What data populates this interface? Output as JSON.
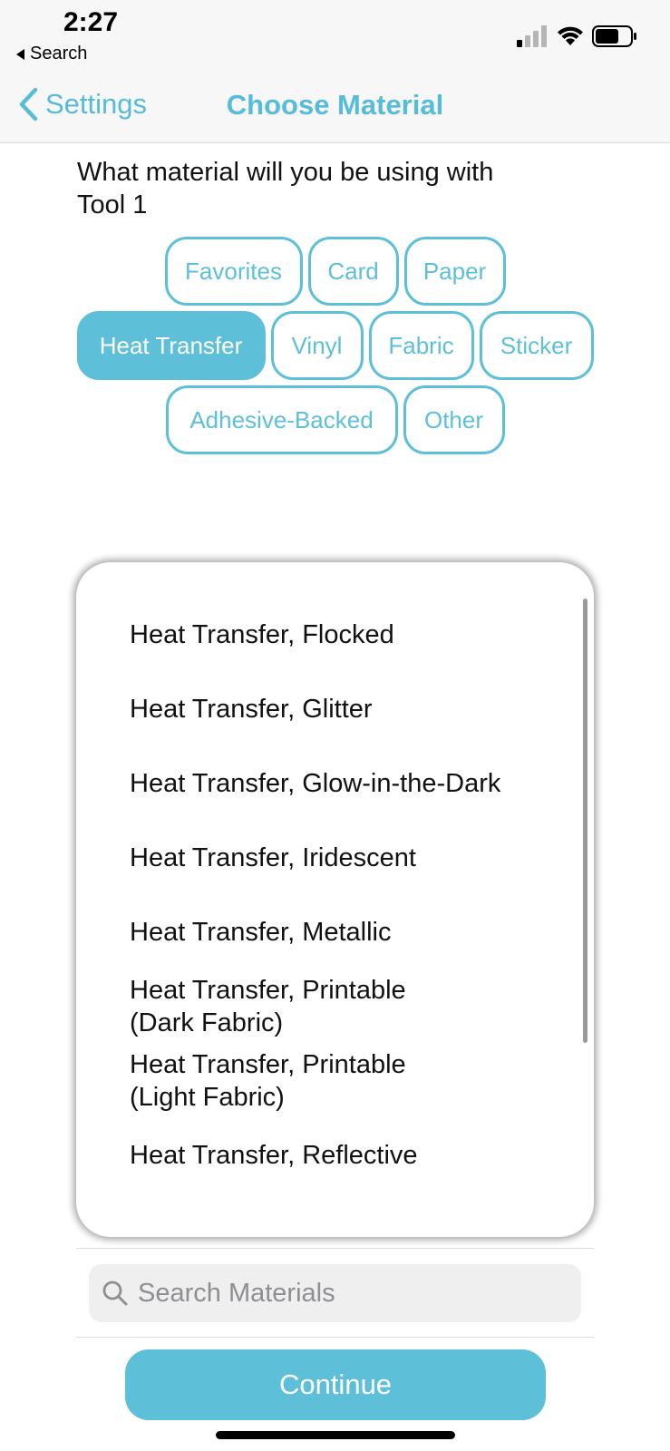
{
  "status_bar": {
    "time": "2:27",
    "back_app_label": "Search"
  },
  "nav": {
    "back_label": "Settings",
    "title": "Choose Material"
  },
  "question": "What material will you be using with Tool 1",
  "categories": {
    "row1": [
      "Favorites",
      "Card",
      "Paper"
    ],
    "row2": [
      "Heat Transfer",
      "Vinyl",
      "Fabric",
      "Sticker"
    ],
    "row3": [
      "Adhesive-Backed",
      "Other"
    ],
    "selected": "Heat Transfer"
  },
  "materials": [
    "Heat Transfer, Flocked",
    "Heat Transfer, Glitter",
    "Heat Transfer, Glow-in-the-Dark",
    "Heat Transfer, Iridescent",
    "Heat Transfer, Metallic",
    "Heat Transfer, Printable (Dark Fabric)",
    "Heat Transfer, Printable (Light Fabric)",
    "Heat Transfer, Reflective"
  ],
  "search": {
    "placeholder": "Search Materials",
    "value": ""
  },
  "continue_label": "Continue",
  "colors": {
    "accent": "#5ebfd9",
    "nav_background": "#f7f7f7"
  }
}
